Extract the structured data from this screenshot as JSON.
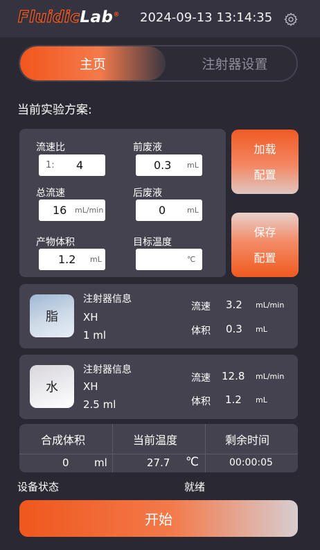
{
  "header": {
    "logo_part1": "Fluid",
    "logo_part2": "ic",
    "logo_part3": "Lab",
    "logo_mark": "®",
    "datetime": "2024-09-13 13:14:35",
    "settings_icon": "gear-icon"
  },
  "tabs": [
    {
      "label": "主页",
      "active": true
    },
    {
      "label": "注射器设置",
      "active": false
    }
  ],
  "section_title": "当前实验方案:",
  "params": {
    "flow_ratio": {
      "label": "流速比",
      "prefix": "1:",
      "value": "4"
    },
    "pre_waste": {
      "label": "前废液",
      "value": "0.3",
      "unit": "mL"
    },
    "total_flow": {
      "label": "总流速",
      "value": "16",
      "unit": "mL/min"
    },
    "post_waste": {
      "label": "后废液",
      "value": "0",
      "unit": "mL"
    },
    "product_volume": {
      "label": "产物体积",
      "value": "1.2",
      "unit": "mL"
    },
    "target_temp": {
      "label": "目标温度",
      "value": "",
      "unit": "℃"
    }
  },
  "buttons": {
    "load_line1": "加载",
    "load_line2": "配置",
    "save_line1": "保存",
    "save_line2": "配置",
    "start": "开始"
  },
  "syringes": [
    {
      "icon_label": "脂",
      "info_title": "注射器信息",
      "model": "XH",
      "size": "1 ml",
      "flow_label": "流速",
      "flow_value": "3.2",
      "flow_unit": "mL/min",
      "volume_label": "体积",
      "volume_value": "0.3",
      "volume_unit": "mL"
    },
    {
      "icon_label": "水",
      "info_title": "注射器信息",
      "model": "XH",
      "size": "2.5 ml",
      "flow_label": "流速",
      "flow_value": "12.8",
      "flow_unit": "mL/min",
      "volume_label": "体积",
      "volume_value": "1.2",
      "volume_unit": "mL"
    }
  ],
  "summary": {
    "headers": [
      "合成体积",
      "当前温度",
      "剩余时间"
    ],
    "synth_volume": "0",
    "synth_volume_unit": "ml",
    "current_temp": "27.7",
    "current_temp_unit": "℃",
    "remaining_time": "00:00:05"
  },
  "status": {
    "label": "设备状态",
    "value": "就绪"
  },
  "colors": {
    "accent": "#f05a1f",
    "background": "#2a2833",
    "panel": "#44424e"
  }
}
